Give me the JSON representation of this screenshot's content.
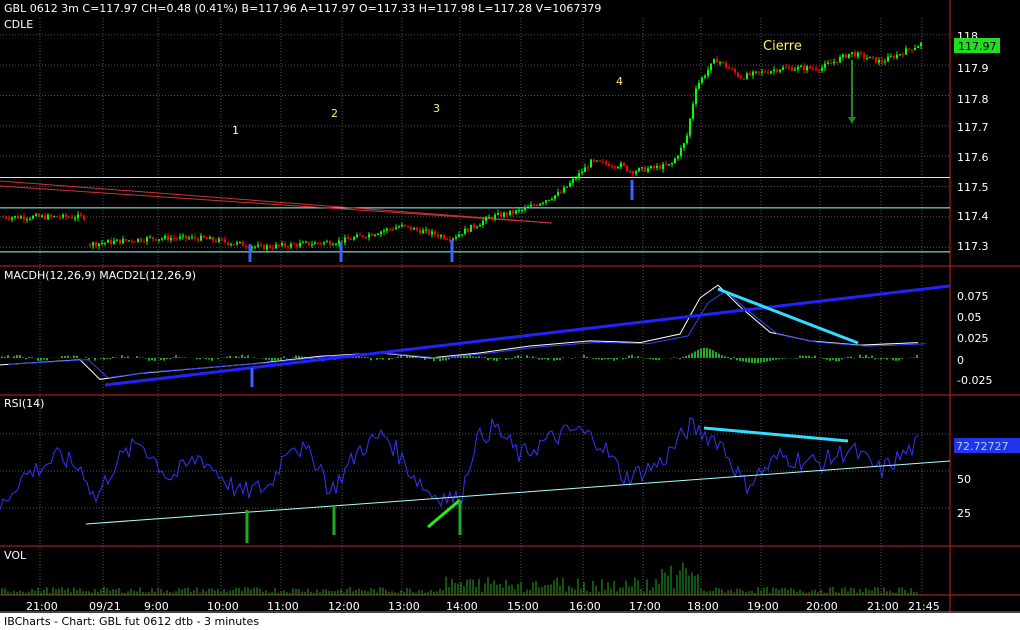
{
  "header": {
    "symbol_line": "GBL 0612 3m   C=117.97  CH=0.48 (0.41%)  B=117.96  A=117.97  O=117.33  H=117.98  L=117.28  V=1067379",
    "study_label": "CDLE"
  },
  "annotations": {
    "waves": [
      "1",
      "2",
      "3",
      "4"
    ],
    "close_label": "Cierre"
  },
  "price_panel": {
    "y_ticks": [
      "118",
      "117.9",
      "117.8",
      "117.7",
      "117.6",
      "117.5",
      "117.4",
      "117.3"
    ],
    "last_price": "117.97",
    "ylim": [
      117.245,
      118.055
    ]
  },
  "macd_panel": {
    "label": "MACDH(12,26,9)  MACD2L(12,26,9)",
    "y_ticks": [
      "0.075",
      "0.05",
      "0.025",
      "0",
      "-0.025"
    ],
    "ylim": [
      -0.042,
      0.105
    ]
  },
  "rsi_panel": {
    "label": "RSI(14)",
    "y_ticks": [
      "50",
      "25"
    ],
    "last_value": "72.72727",
    "ylim": [
      0,
      100
    ]
  },
  "vol_panel": {
    "label": "VOL"
  },
  "x_axis": {
    "ticks": [
      "21:00",
      "09/21",
      "9:00",
      "10:00",
      "11:00",
      "12:00",
      "13:00",
      "14:00",
      "15:00",
      "16:00",
      "17:00",
      "18:00",
      "19:00",
      "20:00",
      "21:00",
      "21:45"
    ]
  },
  "footer": {
    "text": "IBCharts - Chart: GBL fut 0612 dtb - 3 minutes"
  },
  "colors": {
    "up": "#00ff00",
    "down": "#ff0000",
    "grid": "#555555",
    "hline": "#99ffff",
    "trend": "#2222ff",
    "cyan": "#33ddff",
    "annotation": "#ffee66",
    "rsi_line": "#3333ff"
  },
  "chart_data": [
    {
      "type": "candlestick",
      "title": "",
      "x": [
        "21:00",
        "09/21",
        "9:00",
        "10:00",
        "11:00",
        "12:00",
        "13:00",
        "14:00",
        "15:00",
        "16:00",
        "17:00",
        "18:00",
        "19:00",
        "20:00",
        "21:00",
        "21:45"
      ],
      "values": [
        117.4,
        117.3,
        117.32,
        117.31,
        117.3,
        117.33,
        117.36,
        117.33,
        117.4,
        117.5,
        117.57,
        117.85,
        117.87,
        117.89,
        117.92,
        117.97
      ],
      "ylim": [
        117.245,
        118.055
      ]
    },
    {
      "type": "line",
      "title": "",
      "x": [
        "21:00",
        "09/21",
        "9:00",
        "10:00",
        "11:00",
        "12:00",
        "13:00",
        "14:00",
        "15:00",
        "16:00",
        "17:00",
        "18:00",
        "19:00",
        "20:00",
        "21:00",
        "21:45"
      ],
      "values": [
        0.0,
        -0.012,
        -0.005,
        0.0,
        -0.005,
        0.005,
        0.01,
        0.0,
        0.01,
        0.02,
        0.025,
        0.082,
        0.03,
        0.02,
        0.018,
        0.02
      ],
      "ylim": [
        -0.042,
        0.105
      ]
    },
    {
      "type": "line",
      "title": "",
      "x": [
        "21:00",
        "09/21",
        "9:00",
        "10:00",
        "11:00",
        "12:00",
        "13:00",
        "14:00",
        "15:00",
        "16:00",
        "17:00",
        "18:00",
        "19:00",
        "20:00",
        "21:00",
        "21:45"
      ],
      "values": [
        40,
        35,
        55,
        45,
        50,
        40,
        55,
        30,
        65,
        75,
        60,
        78,
        55,
        70,
        60,
        73
      ],
      "ylim": [
        0,
        100
      ]
    }
  ]
}
